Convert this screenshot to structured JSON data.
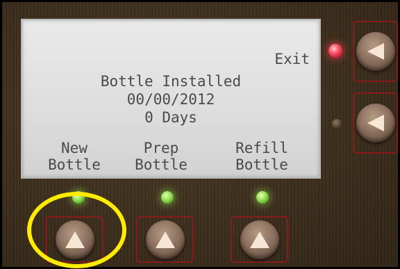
{
  "display": {
    "exit_label": "Exit",
    "status_lines": [
      "Bottle Installed",
      "00/00/2012",
      "0 Days"
    ],
    "softkeys": [
      {
        "line1": "New",
        "line2": "Bottle"
      },
      {
        "line1": "Prep",
        "line2": "Bottle"
      },
      {
        "line1": "Refill",
        "line2": "Bottle"
      }
    ]
  },
  "indicators": {
    "exit_led": "on-red",
    "side_led_2": "off",
    "softkey_leds": [
      "on-green",
      "on-green",
      "on-green"
    ]
  },
  "icons": {
    "side_buttons": "triangle-left-icon",
    "bottom_buttons": "triangle-up-icon"
  },
  "colors": {
    "panel": "#3b2d1c",
    "lcd_background": "#dedede",
    "lcd_text": "#4a4a4a",
    "button_frame": "#8a1a1a",
    "highlight": "#ffec00",
    "led_red": "#ff3a4e",
    "led_green": "#9be15a"
  }
}
